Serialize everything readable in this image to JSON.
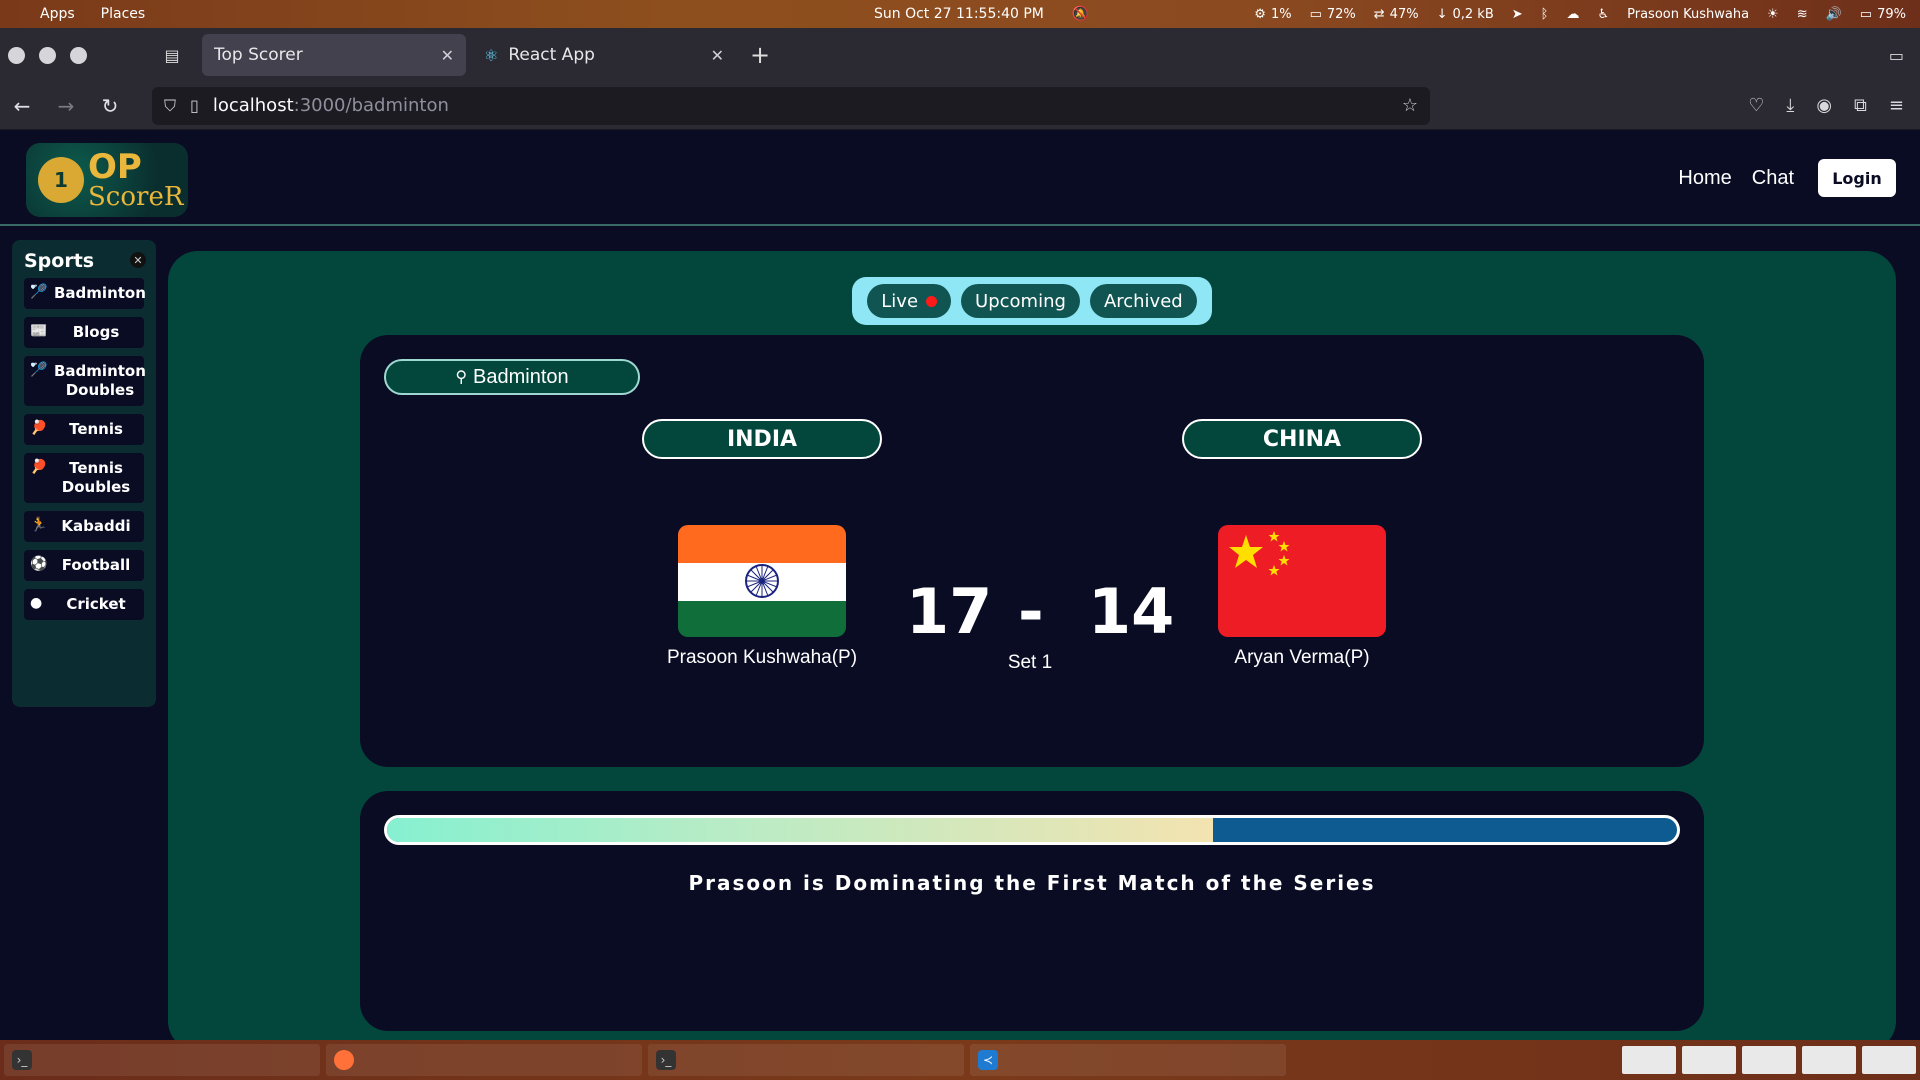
{
  "os_bar": {
    "apps": "Apps",
    "places": "Places",
    "datetime": "Sun Oct 27  11:55:40 PM",
    "cpu": "1%",
    "mem": "72%",
    "swap": "47%",
    "net": "0,2 kB",
    "user": "Prasoon Kushwaha",
    "battery": "79%"
  },
  "browser": {
    "tabs": [
      {
        "title": "Top Scorer"
      },
      {
        "title": "React App"
      }
    ],
    "url_host": "localhost",
    "url_rest": ":3000/badminton"
  },
  "header": {
    "logo_line1": "OP",
    "logo_line2": "ScoreR",
    "nav": {
      "home": "Home",
      "chat": "Chat",
      "login": "Login"
    }
  },
  "sidebar": {
    "title": "Sports",
    "items": [
      {
        "label": "Badminton",
        "icon": "shuttlecock-icon"
      },
      {
        "label": "Blogs",
        "icon": "newspaper-icon"
      },
      {
        "label": "Badminton Doubles",
        "icon": "shuttlecock-icon"
      },
      {
        "label": "Tennis",
        "icon": "table-tennis-icon"
      },
      {
        "label": "Tennis Doubles",
        "icon": "table-tennis-icon"
      },
      {
        "label": "Kabaddi",
        "icon": "running-icon"
      },
      {
        "label": "Football",
        "icon": "football-icon"
      },
      {
        "label": "Cricket",
        "icon": "ball-icon"
      }
    ]
  },
  "filters": {
    "live": "Live",
    "upcoming": "Upcoming",
    "archived": "Archived"
  },
  "match": {
    "sport": "Badminton",
    "team_a": {
      "name": "INDIA",
      "player": "Prasoon Kushwaha(P)",
      "score": "17"
    },
    "team_b": {
      "name": "CHINA",
      "player": "Aryan Verma(P)",
      "score": "14"
    },
    "separator": "-",
    "set": "Set 1"
  },
  "summary": {
    "progress_fraction": 0.64,
    "text": "Prasoon is Dominating the First Match of the Series"
  },
  "colors": {
    "page_bg": "#0a0c24",
    "panel_green": "#03473c",
    "filter_bg": "#8fe6f5",
    "live_dot": "#ff1a1a",
    "progress_track": "#0d5b91"
  }
}
